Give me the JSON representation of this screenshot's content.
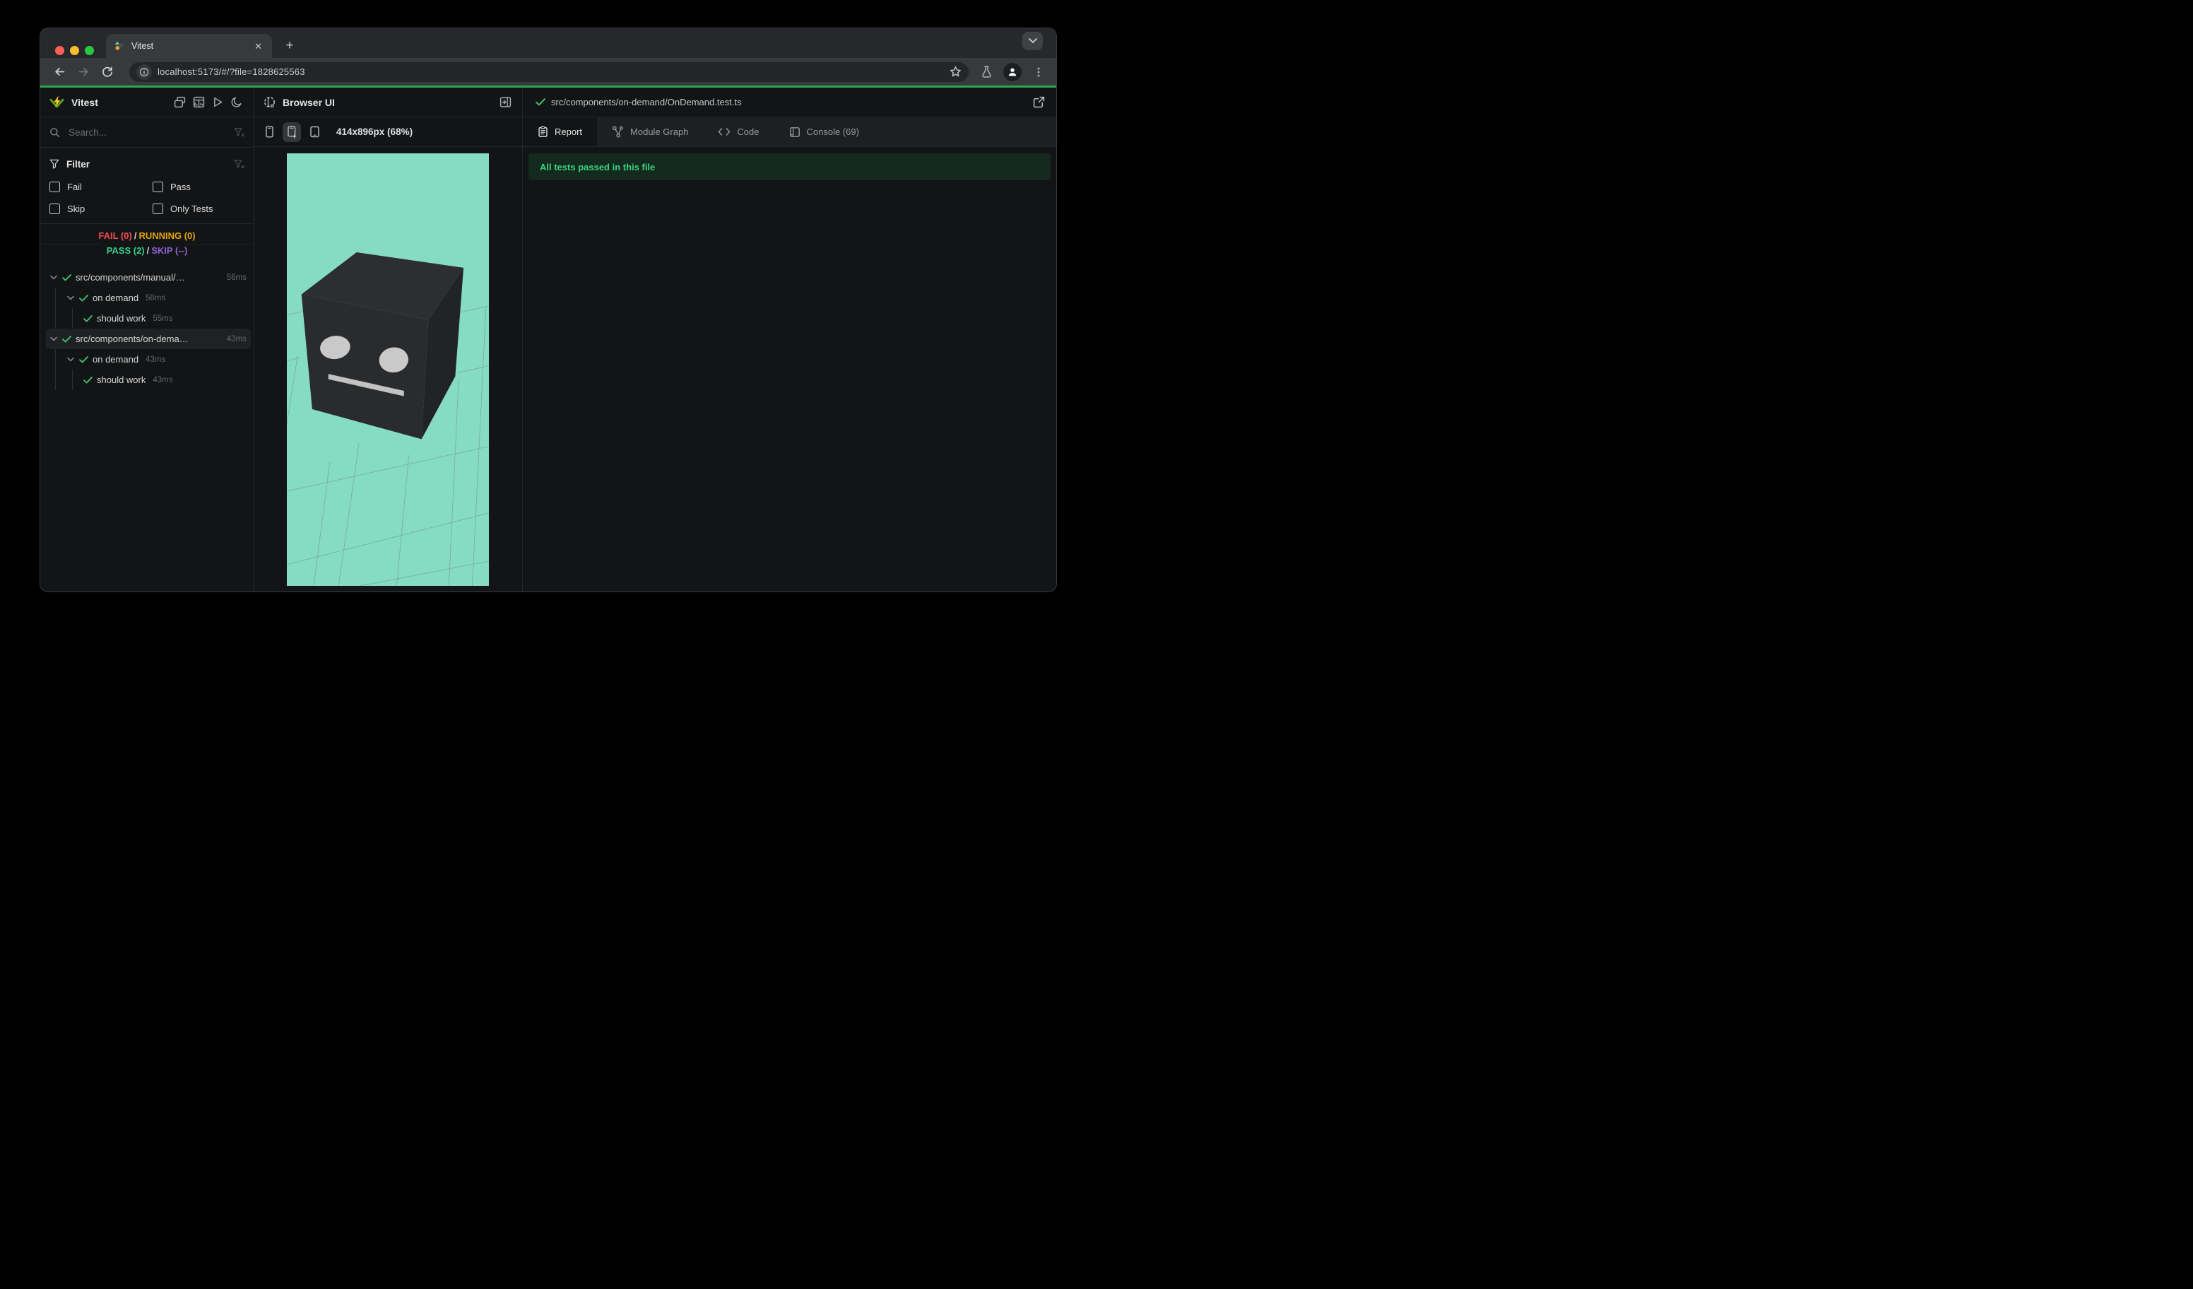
{
  "window": {
    "tab": {
      "title": "Vitest",
      "close": "✕"
    },
    "new_tab": "+",
    "toolbar": {
      "url": "localhost:5173/#/?file=1828625563"
    }
  },
  "sidebar": {
    "app_name": "Vitest",
    "search_placeholder": "Search...",
    "filter": {
      "title": "Filter",
      "options": [
        "Fail",
        "Pass",
        "Skip",
        "Only Tests"
      ]
    },
    "status": {
      "fail": "FAIL (0)",
      "running": "RUNNING (0)",
      "pass": "PASS (2)",
      "skip": "SKIP (--)",
      "separator": "/"
    },
    "tree": [
      {
        "label": "src/components/manual/…",
        "time": "56ms"
      },
      {
        "label": "on demand",
        "time": "56ms"
      },
      {
        "label": "should work",
        "time": "55ms"
      },
      {
        "label": "src/components/on-dema…",
        "time": "43ms"
      },
      {
        "label": "on demand",
        "time": "43ms"
      },
      {
        "label": "should work",
        "time": "43ms"
      }
    ]
  },
  "preview": {
    "title": "Browser UI",
    "viewport_label": "414x896px (68%)"
  },
  "detail": {
    "file_path": "src/components/on-demand/OnDemand.test.ts",
    "tabs": [
      "Report",
      "Module Graph",
      "Code",
      "Console (69)"
    ],
    "active_tab": "Report",
    "banner": "All tests passed in this file"
  },
  "colors": {
    "progress_green": "#2ba84a",
    "pass_green": "#35d08e",
    "fail_red": "#f04a56",
    "running_yellow": "#e2a50d",
    "skip_purple": "#8d63d6",
    "viewport_bg": "#85dcc2",
    "banner_bg": "#152a1e",
    "banner_text": "#38d47e"
  },
  "icons": {
    "search": "magnifier",
    "filter": "funnel",
    "clear-filter": "funnel-x",
    "run": "play-triangle",
    "theme": "moon",
    "preview": "globe",
    "report": "clipboard",
    "module_graph": "node-graph",
    "code": "angle-brackets",
    "console": "terminal",
    "open_external": "external-link"
  }
}
